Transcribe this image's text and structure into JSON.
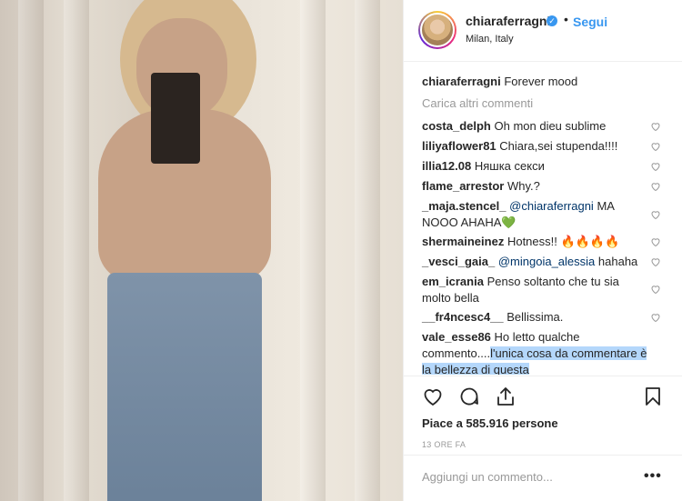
{
  "header": {
    "username": "chiaraferragni",
    "verified_mark": "✓",
    "separator": "•",
    "follow_label": "Segui",
    "location": "Milan, Italy"
  },
  "caption": {
    "username": "chiaraferragni",
    "text": "Forever mood"
  },
  "load_more_label": "Carica altri commenti",
  "comments": [
    {
      "username": "costa_delph",
      "text": "Oh mon dieu sublime"
    },
    {
      "username": "liliyaflower81",
      "text": "Chiara,sei stupenda!!!!"
    },
    {
      "username": "illia12.08",
      "text": "Няшка секси"
    },
    {
      "username": "flame_arrestor",
      "text": "Why.?"
    },
    {
      "username": "_maja.stencel_",
      "mention": "@chiaraferragni",
      "text": "MA NOOO AHAHA💚"
    },
    {
      "username": "shermaineinez",
      "text": "Hotness!! 🔥🔥🔥🔥"
    },
    {
      "username": "_vesci_gaia_",
      "mention": "@mingoia_alessia",
      "text": "hahaha"
    },
    {
      "username": "em_icrania",
      "text": "Penso soltanto che tu sia molto bella"
    },
    {
      "username": "__fr4ncesc4__",
      "text": "Bellissima."
    },
    {
      "username": "vale_esse86",
      "text": "Ho letto qualche commento....",
      "highlighted_text": "l'unica cosa da commentare è la bellezza di questa"
    }
  ],
  "likes_text": "Piace a 585.916 persone",
  "timestamp": "13 ORE FA",
  "add_comment": {
    "placeholder": "Aggiungi un commento..."
  },
  "options_label": "•••",
  "icons": {
    "like": "heart-icon",
    "comment": "comment-icon",
    "share": "share-icon",
    "save": "bookmark-icon",
    "comment_like": "heart-icon"
  }
}
